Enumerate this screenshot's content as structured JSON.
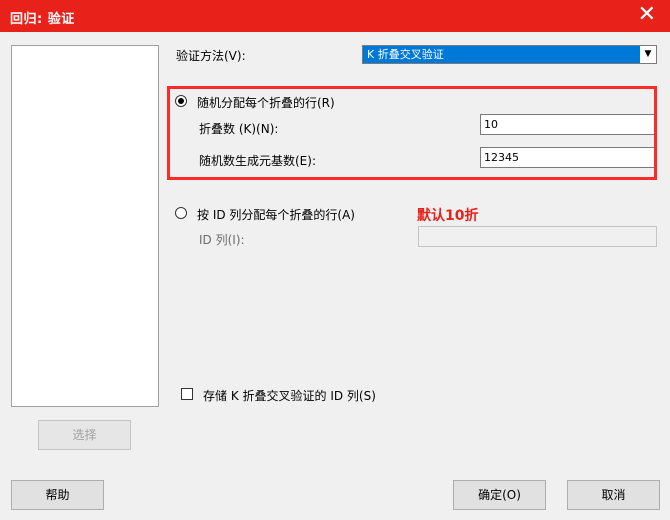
{
  "window": {
    "title": "回归: 验证",
    "close_glyph": "✕"
  },
  "variables_list": {
    "select_button": "选择"
  },
  "method": {
    "label": "验证方法(V):",
    "selected": "K 折叠交叉验证",
    "arrow_glyph": "▼"
  },
  "random_fold": {
    "label": "随机分配每个折叠的行(R)",
    "folds_label": "折叠数 (K)(N):",
    "folds_value": "10",
    "seed_label": "随机数生成元基数(E):",
    "seed_value": "12345"
  },
  "id_fold": {
    "label": "按 ID 列分配每个折叠的行(A)",
    "id_column_label": "ID 列(I):",
    "id_column_value": ""
  },
  "annotation": {
    "text": "默认10折"
  },
  "store_checkbox": {
    "label": "存储 K 折叠交叉验证的 ID 列(S)"
  },
  "buttons": {
    "help": "帮助",
    "ok": "确定(O)",
    "cancel": "取消"
  },
  "colors": {
    "titlebar": "#e8221b",
    "highlight": "#ff2a2a",
    "selection": "#0078d7"
  }
}
